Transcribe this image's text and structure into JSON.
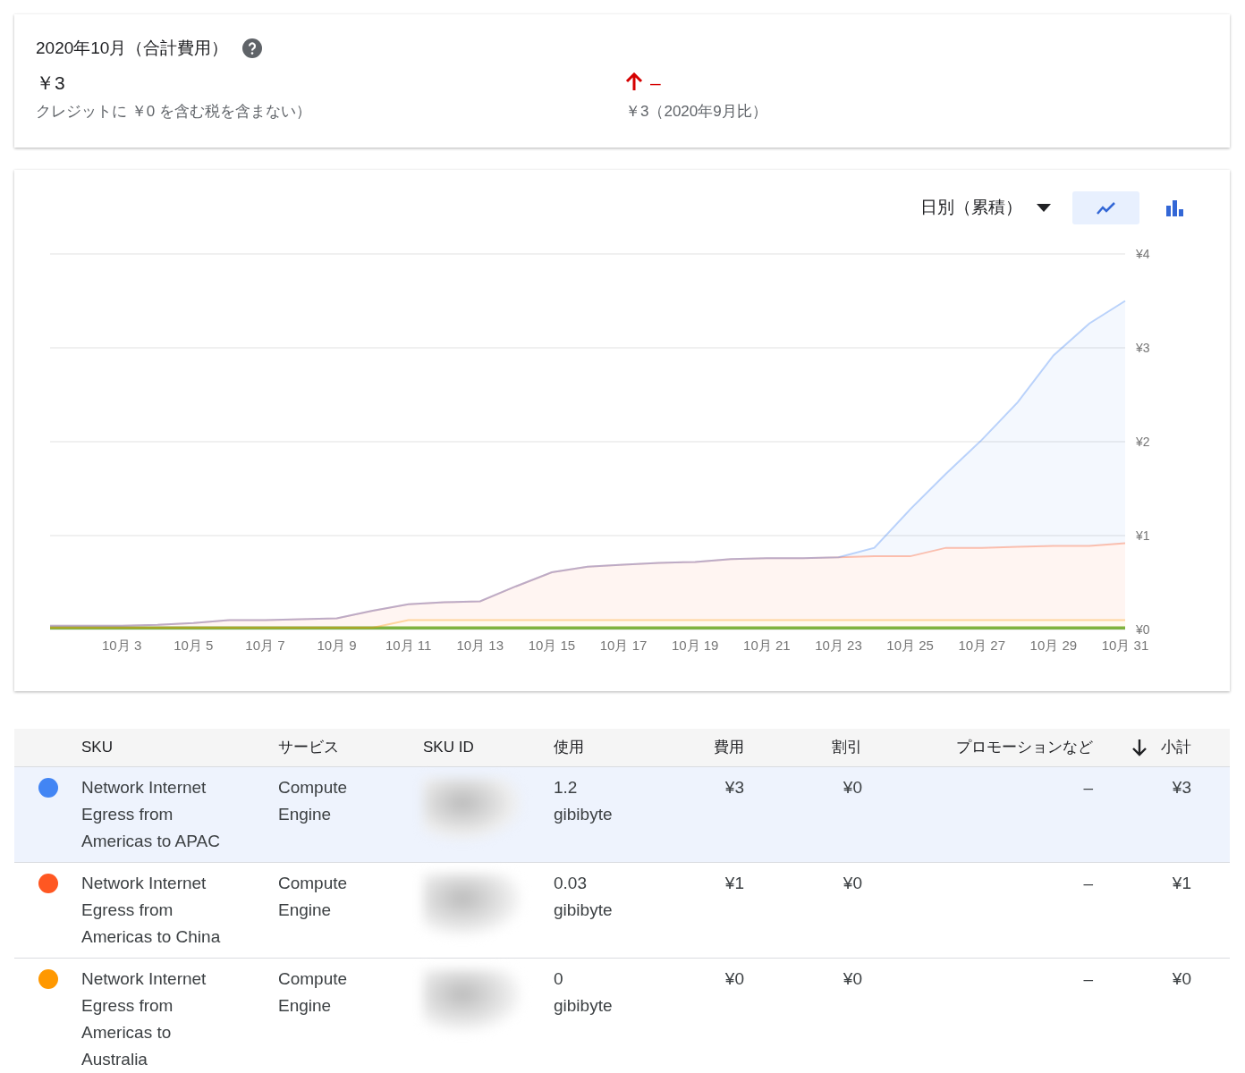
{
  "summary": {
    "title": "2020年10月（合計費用）",
    "amount": "￥3",
    "note": "クレジットに ￥0 を含む税を含まない）",
    "trend": {
      "increase": true,
      "change": "–",
      "comparison": "￥3（2020年9月比）"
    }
  },
  "chart_controls": {
    "period": "日別（累積）",
    "views": [
      {
        "kind": "line",
        "selected": true
      },
      {
        "kind": "bar",
        "selected": false
      }
    ]
  },
  "chart": {
    "chart_data": {
      "type": "area",
      "stacked": true,
      "grid": true,
      "categories": [
        null,
        null,
        "10月 3",
        null,
        "10月 5",
        null,
        "10月 7",
        null,
        "10月 9",
        null,
        "10月 11",
        null,
        "10月 13",
        null,
        "10月 15",
        null,
        "10月 17",
        null,
        "10月 19",
        null,
        "10月 21",
        null,
        "10月 23",
        null,
        "10月 25",
        null,
        "10月 27",
        null,
        "10月 29",
        null,
        "10月 31"
      ],
      "ylim": [
        0,
        4
      ],
      "yticks": [
        {
          "value": 0,
          "label": "¥0"
        },
        {
          "value": 1,
          "label": "¥1"
        },
        {
          "value": 2,
          "label": "¥2"
        },
        {
          "value": 3,
          "label": "¥3"
        },
        {
          "value": 4,
          "label": "¥4"
        }
      ],
      "series": [
        {
          "color": "#7cb342",
          "values": [
            0.02,
            0.02,
            0.02,
            0.02,
            0.02,
            0.02,
            0.02,
            0.02,
            0.02,
            0.02,
            0.02,
            0.02,
            0.02,
            0.02,
            0.02,
            0.02,
            0.02,
            0.02,
            0.02,
            0.02,
            0.02,
            0.02,
            0.02,
            0.02,
            0.02,
            0.02,
            0.02,
            0.02,
            0.02,
            0.02,
            0.02
          ]
        },
        {
          "color": "#ff9800",
          "values": [
            0,
            0,
            0,
            0,
            0,
            0,
            0,
            0,
            0,
            0,
            0.08,
            0.08,
            0.08,
            0.08,
            0.08,
            0.08,
            0.08,
            0.08,
            0.08,
            0.08,
            0.08,
            0.08,
            0.08,
            0.08,
            0.08,
            0.08,
            0.08,
            0.08,
            0.08,
            0.08,
            0.08
          ]
        },
        {
          "color": "#ff5722",
          "values": [
            0.02,
            0.02,
            0.02,
            0.03,
            0.05,
            0.08,
            0.08,
            0.09,
            0.1,
            0.18,
            0.17,
            0.19,
            0.2,
            0.36,
            0.51,
            0.57,
            0.59,
            0.61,
            0.62,
            0.65,
            0.66,
            0.66,
            0.67,
            0.68,
            0.68,
            0.77,
            0.77,
            0.78,
            0.79,
            0.79,
            0.82
          ]
        },
        {
          "color": "#4285f4",
          "values": [
            0,
            0,
            0,
            0,
            0,
            0,
            0,
            0,
            0,
            0,
            0,
            0,
            0,
            0,
            0,
            0,
            0,
            0,
            0,
            0,
            0,
            0,
            0,
            0.09,
            0.5,
            0.79,
            1.15,
            1.54,
            2.03,
            2.37,
            2.58
          ]
        }
      ]
    }
  },
  "table": {
    "columns": [
      {
        "label": "SKU",
        "sorted": false
      },
      {
        "label": "サービス",
        "sorted": false
      },
      {
        "label": "SKU ID",
        "sorted": false
      },
      {
        "label": "使用",
        "sorted": false
      },
      {
        "label": "費用",
        "sorted": false
      },
      {
        "label": "割引",
        "sorted": false
      },
      {
        "label": "プロモーションなど",
        "sorted": false
      },
      {
        "label": "小計",
        "sorted": true
      }
    ],
    "rows": [
      {
        "color": "#4285f4",
        "selected": true,
        "cells": [
          "Network Internet Egress from Americas to APAC",
          "Compute Engine",
          "",
          "1.2 gibibyte",
          "¥3",
          "¥0",
          "–",
          "¥3"
        ]
      },
      {
        "color": "#ff5722",
        "selected": false,
        "cells": [
          "Network Internet Egress from Americas to China",
          "Compute Engine",
          "",
          "0.03 gibibyte",
          "¥1",
          "¥0",
          "–",
          "¥1"
        ]
      },
      {
        "color": "#ff9800",
        "selected": false,
        "cells": [
          "Network Internet Egress from Americas to Australia",
          "Compute Engine",
          "",
          "0 gibibyte",
          "¥0",
          "¥0",
          "–",
          "¥0"
        ]
      }
    ]
  }
}
